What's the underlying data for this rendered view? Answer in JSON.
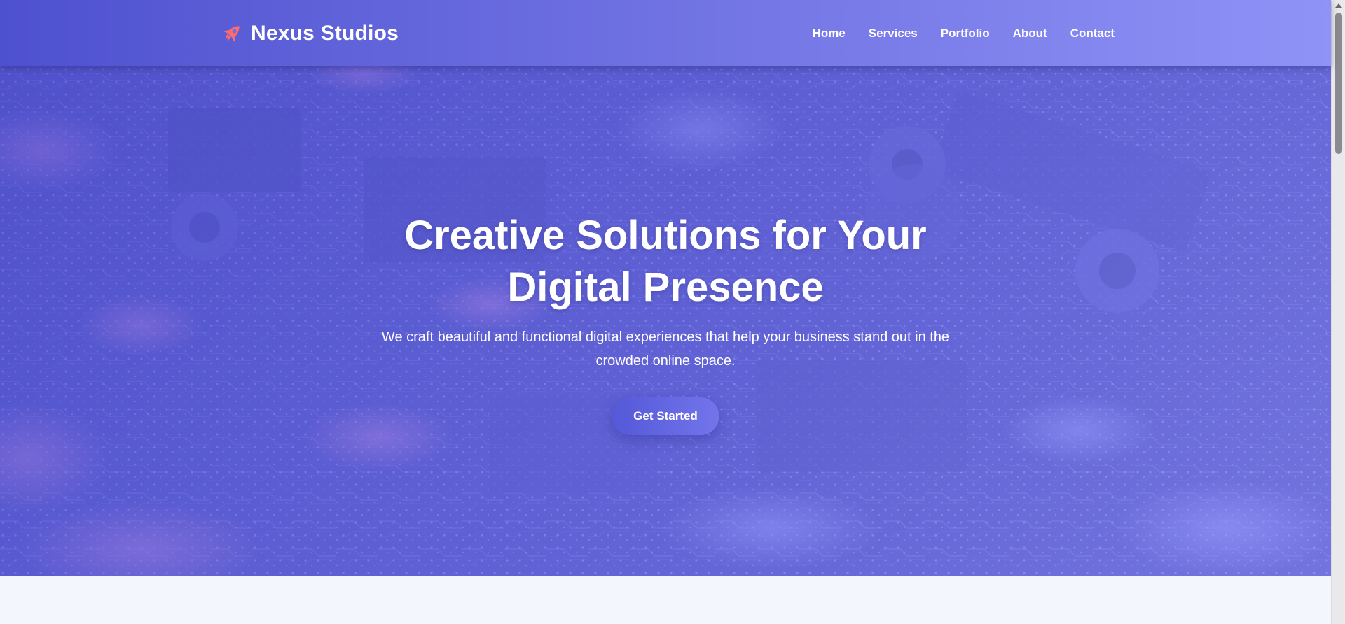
{
  "header": {
    "brand": "Nexus Studios",
    "logo_icon": "rocket-icon",
    "nav": [
      {
        "label": "Home"
      },
      {
        "label": "Services"
      },
      {
        "label": "Portfolio"
      },
      {
        "label": "About"
      },
      {
        "label": "Contact"
      }
    ]
  },
  "hero": {
    "title_line1": "Creative Solutions for Your",
    "title_line2": "Digital Presence",
    "subtitle": "We craft beautiful and functional digital experiences that help your business stand out in the crowded online space.",
    "cta_label": "Get Started",
    "background": "circuit-board-photo"
  },
  "colors": {
    "header_start": "#4e51cf",
    "header_end": "#8f92f6",
    "accent": "#5558d8",
    "logo_rocket": "#ff6b6b",
    "page_bg": "#f4f6fd"
  }
}
